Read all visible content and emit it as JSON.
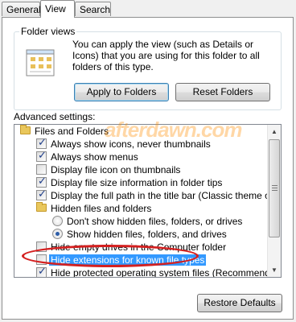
{
  "tabs": [
    {
      "label": "General",
      "active": false
    },
    {
      "label": "View",
      "active": true
    },
    {
      "label": "Search",
      "active": false
    }
  ],
  "folder_views": {
    "title": "Folder views",
    "description": "You can apply the view (such as Details or Icons) that you are using for this folder to all folders of this type.",
    "apply_button": "Apply to Folders",
    "reset_button": "Reset Folders"
  },
  "advanced": {
    "label": "Advanced settings:",
    "items": [
      {
        "kind": "folder",
        "label": "Files and Folders"
      },
      {
        "kind": "checkbox",
        "checked": true,
        "label": "Always show icons, never thumbnails"
      },
      {
        "kind": "checkbox",
        "checked": true,
        "label": "Always show menus"
      },
      {
        "kind": "checkbox",
        "checked": false,
        "label": "Display file icon on thumbnails"
      },
      {
        "kind": "checkbox",
        "checked": true,
        "label": "Display file size information in folder tips"
      },
      {
        "kind": "checkbox",
        "checked": true,
        "label": "Display the full path in the title bar (Classic theme only)"
      },
      {
        "kind": "folder",
        "label": "Hidden files and folders"
      },
      {
        "kind": "radio",
        "checked": false,
        "label": "Don't show hidden files, folders, or drives"
      },
      {
        "kind": "radio",
        "checked": true,
        "label": "Show hidden files, folders, and drives"
      },
      {
        "kind": "checkbox",
        "checked": false,
        "label": "Hide empty drives in the Computer folder"
      },
      {
        "kind": "checkbox",
        "checked": false,
        "label": "Hide extensions for known file types",
        "selected": true
      },
      {
        "kind": "checkbox",
        "checked": true,
        "label": "Hide protected operating system files (Recommended)"
      }
    ]
  },
  "restore_button": "Restore Defaults",
  "watermark": "afterdawn.com",
  "colors": {
    "selection": "#3399ff",
    "highlight_ellipse": "#d42020",
    "check": "#1e3d8a"
  }
}
